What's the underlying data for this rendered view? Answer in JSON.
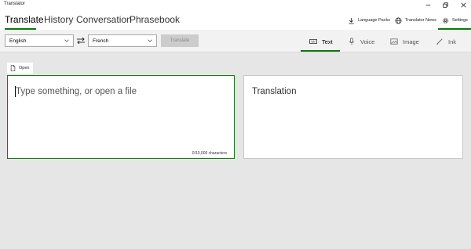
{
  "app": {
    "title": "Translator"
  },
  "nav": {
    "tabs": [
      {
        "label": "Translate",
        "active": true
      },
      {
        "label": "History"
      },
      {
        "label": "Conversation"
      },
      {
        "label": "Phrasebook"
      }
    ],
    "actions": [
      {
        "label": "Language Packs",
        "icon": "download-icon"
      },
      {
        "label": "Translator News",
        "icon": "globe-icon"
      },
      {
        "label": "Settings",
        "icon": "gear-icon",
        "active": true
      }
    ]
  },
  "languages": {
    "source": "English",
    "target": "French"
  },
  "translate_button": {
    "label": "Translate",
    "enabled": false
  },
  "modes": [
    {
      "label": "Text",
      "icon": "keyboard-icon",
      "active": true
    },
    {
      "label": "Voice",
      "icon": "microphone-icon"
    },
    {
      "label": "Image",
      "icon": "image-icon"
    },
    {
      "label": "Ink",
      "icon": "pen-icon"
    }
  ],
  "open_button": {
    "label": "Open",
    "icon": "document-icon"
  },
  "input": {
    "placeholder": "Type something, or open a file",
    "char_count": "0/10,000 characters"
  },
  "output": {
    "label": "Translation"
  },
  "colors": {
    "accent": "#107c10",
    "background": "#e6e6e6"
  }
}
